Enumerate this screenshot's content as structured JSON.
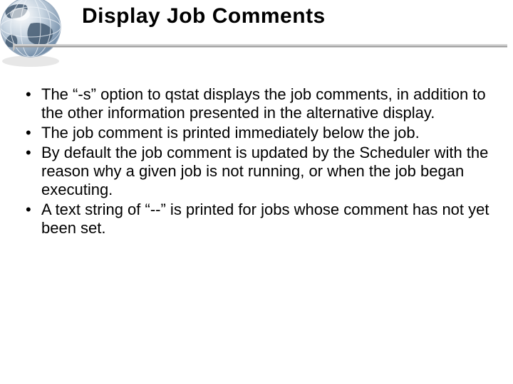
{
  "title": "Display Job Comments",
  "bullets": [
    "The “-s” option to qstat displays the job comments, in addition to the other information presented in the alternative display.",
    "The job comment is printed immediately below the job.",
    "By default the job comment is updated by the Scheduler with the reason why a given job is not running, or when the job began executing.",
    "A text string of “--” is printed for jobs whose comment has not yet been set."
  ],
  "decor": {
    "accent": "#6f8aa6",
    "accent_dark": "#4b6177",
    "underline_light": "#d4d4d4",
    "underline_dark": "#9a9a9a"
  }
}
